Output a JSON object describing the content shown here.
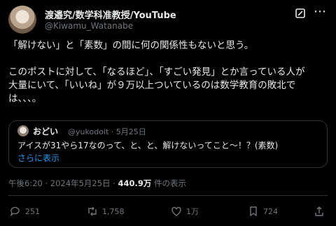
{
  "author": {
    "name": "渡邉究/数学科准教授/YouTube",
    "handle": "@Kiwamu_Watanabe"
  },
  "post": {
    "line1": "「解けない」と「素数」の間に何の関係性もないと思う。",
    "line2": "このポストに対して、「なるほど」、「すごい発見」とか言っている人が",
    "line3": "大量にいて、「いいね」が９万以上ついているのは数学教育の敗北で",
    "line4": "は、、、。"
  },
  "quote": {
    "name": "おどい",
    "handle_date": "@yukodoit · 5月25日",
    "text": "アイスが31やら17なのって、と、と、解けないってこと～！？(素数)",
    "show_more": "さらに表示"
  },
  "meta": {
    "time_date": "午後6:20 · 2024年5月25日 · ",
    "views": "440.9万",
    "views_suffix": " 件の表示"
  },
  "actions": {
    "replies": "251",
    "reposts": "1,758",
    "likes": "1万",
    "bookmarks": "724"
  },
  "icons": {
    "grok": "grok-icon",
    "more": "more-icon",
    "reply": "reply-icon",
    "repost": "repost-icon",
    "like": "heart-icon",
    "bookmark": "bookmark-icon",
    "share": "share-icon"
  },
  "colors": {
    "background": "#000000",
    "text": "#e7e9ea",
    "secondary": "#71767b",
    "link": "#1d9bf0",
    "border": "#2f3336"
  }
}
